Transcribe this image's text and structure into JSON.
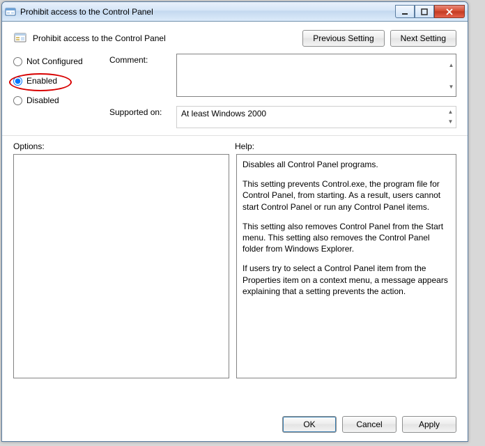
{
  "window": {
    "title": "Prohibit access to the Control Panel"
  },
  "header": {
    "title": "Prohibit access to the Control Panel",
    "prev": "Previous Setting",
    "next": "Next Setting"
  },
  "radios": {
    "not_configured": "Not Configured",
    "enabled": "Enabled",
    "disabled": "Disabled",
    "selected": "enabled"
  },
  "fields": {
    "comment_label": "Comment:",
    "comment_value": "",
    "supported_label": "Supported on:",
    "supported_value": "At least Windows 2000"
  },
  "sections": {
    "options_label": "Options:",
    "help_label": "Help:"
  },
  "help": {
    "p1": "Disables all Control Panel programs.",
    "p2": "This setting prevents Control.exe, the program file for Control Panel, from starting. As a result, users cannot start Control Panel or run any Control Panel items.",
    "p3": "This setting also removes Control Panel from the Start menu. This setting also removes the Control Panel folder from Windows Explorer.",
    "p4": "If users try to select a Control Panel item from the Properties item on a context menu, a message appears explaining that a setting prevents the action."
  },
  "footer": {
    "ok": "OK",
    "cancel": "Cancel",
    "apply": "Apply"
  }
}
